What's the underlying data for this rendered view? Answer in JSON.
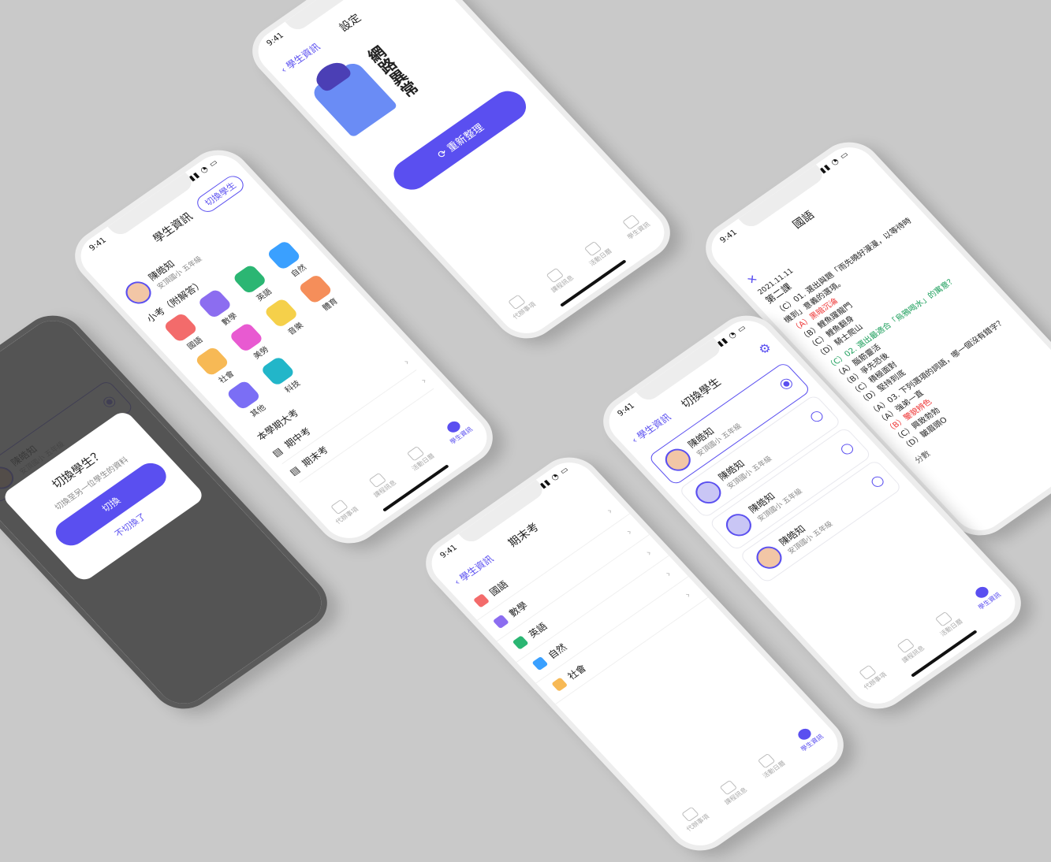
{
  "status": {
    "time": "9:41"
  },
  "tabbar": {
    "tab1": "代辦事項",
    "tab2": "課程訊息",
    "tab3": "活動日曆",
    "tab4": "學生資訊"
  },
  "student": {
    "name": "陳皓知",
    "school": "安頂國小 五年級"
  },
  "student_info": {
    "title": "學生資訊",
    "switch_label": "切換學生",
    "quiz_section": "小考（附解答）",
    "subjects": [
      "國語",
      "數學",
      "英語",
      "自然",
      "社會",
      "美勞",
      "音樂",
      "體育",
      "其他",
      "科技"
    ],
    "exam_section": "本學期大考",
    "exams": [
      "期中考",
      "期末考"
    ]
  },
  "settings": {
    "back": "學生資訊",
    "title": "設定",
    "error_text": "網路異常",
    "reload": "重新整理"
  },
  "final_exam": {
    "back": "學生資訊",
    "title": "期末考",
    "subjects": [
      "國語",
      "數學",
      "英語",
      "自然",
      "社會"
    ]
  },
  "switch_student": {
    "back": "學生資訊",
    "title": "切換學生",
    "students": [
      {
        "name": "陳皓知",
        "school": "安頂國小 五年級"
      },
      {
        "name": "陳皓知",
        "school": "安頂國小 五年級"
      },
      {
        "name": "陳皓知",
        "school": "安頂國小 五年級"
      },
      {
        "name": "陳皓知",
        "school": "安頂國小 五年級"
      }
    ]
  },
  "quiz_detail": {
    "title": "國語",
    "date": "2021.11.11",
    "chapter": "第二課",
    "q1": "（C）01. 選出與題「雨先曉好漫漫，以等待時機到」意義的選項。",
    "q1a": "（A）黑暗沉淪",
    "q1b": "（B）鯉魚躍龍門",
    "q1c": "（C）鯉魚翻身",
    "q1d": "（D）騎士爬山",
    "q2": "（C）02. 選出最適合「烏鴉喝水」的寓意？",
    "q2a": "（A）腦筋靈活",
    "q2b": "（B）爭先恐後",
    "q2c": "（C）積極面對",
    "q2d": "（D）堅持到底",
    "q3": "（A）03. 下列選項的詞語，哪一個沒有錯字？",
    "q3a": "（A）強弟一直",
    "q3b": "（B）鑒貌辨色",
    "q3c": "（C）興致勃勃",
    "q3d": "（D）皺眉頭O",
    "score_label": "分數"
  },
  "dialog": {
    "partial_title": "學生",
    "title": "切換學生？",
    "desc": "切換至另一位學生的資料",
    "confirm": "切換",
    "cancel": "不切換了"
  },
  "colors": {
    "accent": "#5a4ff0",
    "background": "#c9c9c9"
  }
}
